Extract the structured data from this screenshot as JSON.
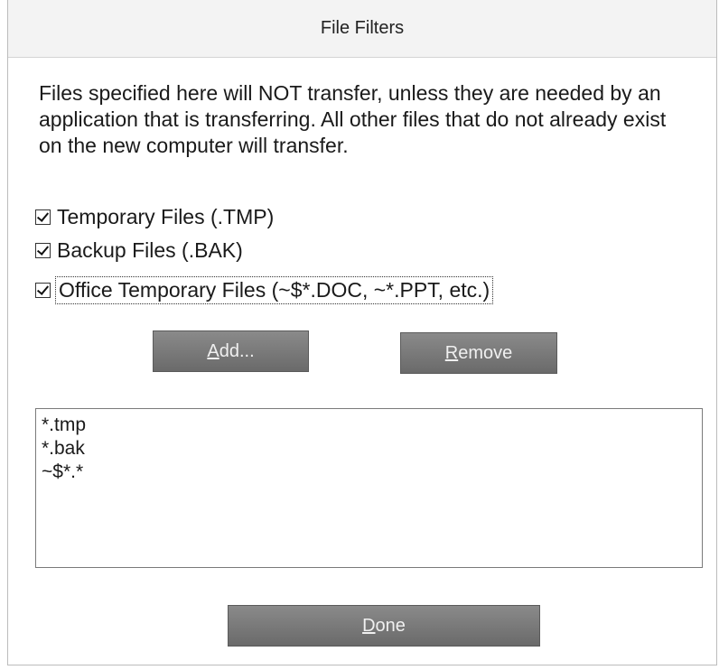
{
  "window": {
    "title": "File Filters"
  },
  "description": "Files specified here will NOT transfer, unless they are needed by an application that is transferring. All other files that do not already exist on the new computer will transfer.",
  "filters": [
    {
      "label": "Temporary Files (.TMP)",
      "checked": true
    },
    {
      "label": "Backup Files (.BAK)",
      "checked": true
    },
    {
      "label": "Office Temporary Files (~$*.DOC, ~*.PPT, etc.)",
      "checked": true
    }
  ],
  "buttons": {
    "add": {
      "mnemonic": "A",
      "rest": "dd..."
    },
    "remove": {
      "mnemonic": "R",
      "rest": "emove"
    },
    "done": {
      "mnemonic": "D",
      "rest": "one"
    }
  },
  "patterns": [
    "*.tmp",
    "*.bak",
    "~$*.*"
  ]
}
